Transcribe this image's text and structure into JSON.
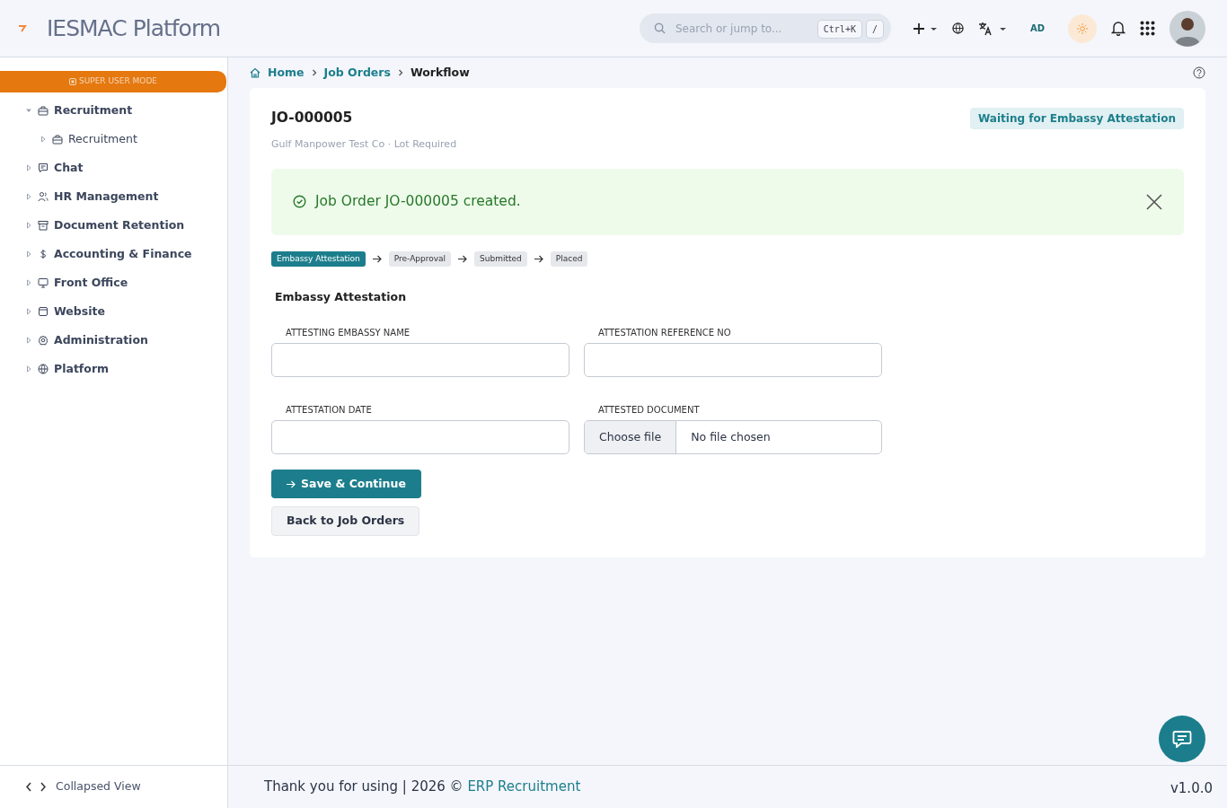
{
  "header": {
    "title": "IESMAC Platform",
    "search": {
      "placeholder": "Search or jump to...",
      "keys": [
        "Ctrl+K",
        "/"
      ]
    },
    "language_code": "AD"
  },
  "sidebar": {
    "mode_banner": "SUPER USER MODE",
    "items": [
      {
        "label": "Recruitment",
        "kind": "briefcase",
        "expanded": true,
        "children": [
          {
            "label": "Recruitment",
            "kind": "briefcase",
            "expanded": false
          }
        ]
      },
      {
        "label": "Chat",
        "kind": "chat",
        "expanded": false
      },
      {
        "label": "HR Management",
        "kind": "people",
        "expanded": false
      },
      {
        "label": "Document Retention",
        "kind": "archive",
        "expanded": false
      },
      {
        "label": "Accounting & Finance",
        "kind": "dollar",
        "expanded": false
      },
      {
        "label": "Front Office",
        "kind": "monitor",
        "expanded": false
      },
      {
        "label": "Website",
        "kind": "window",
        "expanded": false
      },
      {
        "label": "Administration",
        "kind": "gear",
        "expanded": false
      },
      {
        "label": "Platform",
        "kind": "globe",
        "expanded": false
      }
    ],
    "footer": "Collapsed View"
  },
  "breadcrumb": [
    "Home",
    "Job Orders",
    "Workflow"
  ],
  "job": {
    "title": "JO-000005",
    "subtitle": "Gulf Manpower Test Co · Lot Required",
    "status": "Waiting for Embassy Attestation"
  },
  "alert": {
    "message": "Job Order JO-000005 created."
  },
  "steps": [
    {
      "label": "Embassy Attestation",
      "selected": true
    },
    {
      "label": "Pre-Approval",
      "selected": false
    },
    {
      "label": "Submitted",
      "selected": false
    },
    {
      "label": "Placed",
      "selected": false
    }
  ],
  "form": {
    "title": "Embassy Attestation",
    "fields": [
      {
        "label": "ATTESTING EMBASSY NAME",
        "kind": "text"
      },
      {
        "label": "ATTESTATION REFERENCE NO",
        "kind": "text"
      },
      {
        "label": "ATTESTATION DATE",
        "kind": "text"
      },
      {
        "label": "ATTESTED DOCUMENT",
        "kind": "file",
        "button": "Choose file",
        "value": "No file chosen"
      }
    ],
    "buttons": [
      {
        "label": "Save & Continue",
        "kind": "primary"
      },
      {
        "label": "Back to Job Orders",
        "kind": "secondary"
      }
    ]
  },
  "footer": {
    "text": "Thank you for using | 2026 ©",
    "link": "ERP Recruitment",
    "version": "v1.0.0"
  }
}
